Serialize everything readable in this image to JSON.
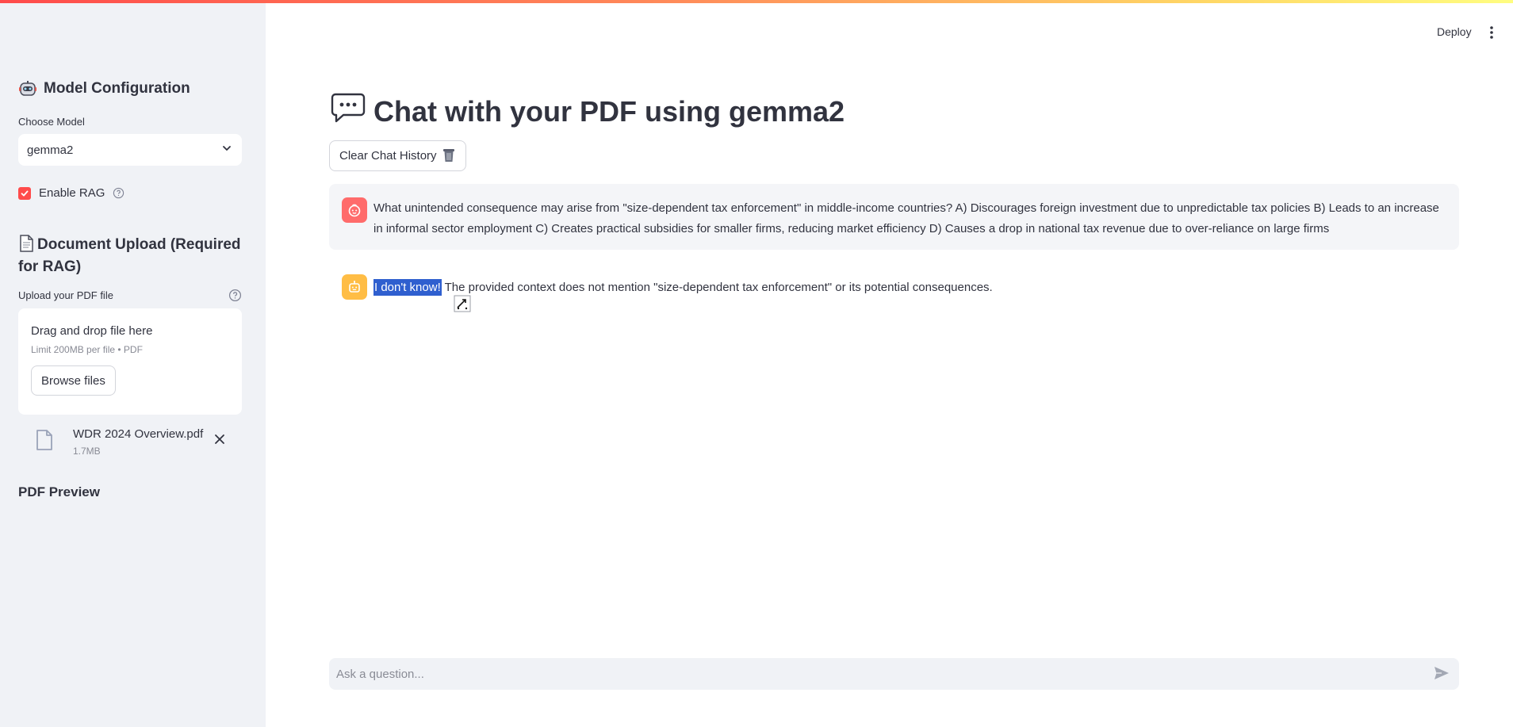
{
  "sidebar": {
    "config_title": "Model Configuration",
    "choose_model_label": "Choose Model",
    "selected_model": "gemma2",
    "enable_rag_label": "Enable RAG",
    "enable_rag_checked": true,
    "doc_upload_title": "Document Upload (Required for RAG)",
    "upload_label": "Upload your PDF file",
    "dropzone_title": "Drag and drop file here",
    "dropzone_limit": "Limit 200MB per file • PDF",
    "browse_label": "Browse files",
    "file": {
      "name": "WDR 2024 Overview.pdf",
      "size": "1.7MB"
    },
    "pdf_preview_title": "PDF Preview"
  },
  "header": {
    "deploy_label": "Deploy"
  },
  "main": {
    "title": "Chat with your PDF using gemma2",
    "clear_button_label": "Clear Chat History",
    "messages": [
      {
        "role": "user",
        "text": "What unintended consequence may arise from \"size-dependent tax enforcement\" in middle-income countries? A) Discourages foreign investment due to unpredictable tax policies B) Leads to an increase in informal sector employment C) Creates practical subsidies for smaller firms, reducing market efficiency D) Causes a drop in national tax revenue due to over-reliance on large firms"
      },
      {
        "role": "assistant",
        "highlighted": "I don't know!",
        "text": " The provided context does not mention \"size-dependent tax enforcement\" or its potential consequences."
      }
    ],
    "input_placeholder": "Ask a question..."
  },
  "colors": {
    "accent": "#ff4b4b",
    "sidebar_bg": "#f0f2f6",
    "user_avatar": "#ff6b6b",
    "bot_avatar": "#ffbd45",
    "selection": "#2f5fcf"
  },
  "icons": [
    "robot-emoji-icon",
    "chevron-down-icon",
    "help-icon",
    "page-emoji-icon",
    "file-icon",
    "close-icon",
    "more-vert-icon",
    "speech-bubble-icon",
    "trash-icon",
    "user-avatar-icon",
    "bot-avatar-icon",
    "send-icon"
  ]
}
